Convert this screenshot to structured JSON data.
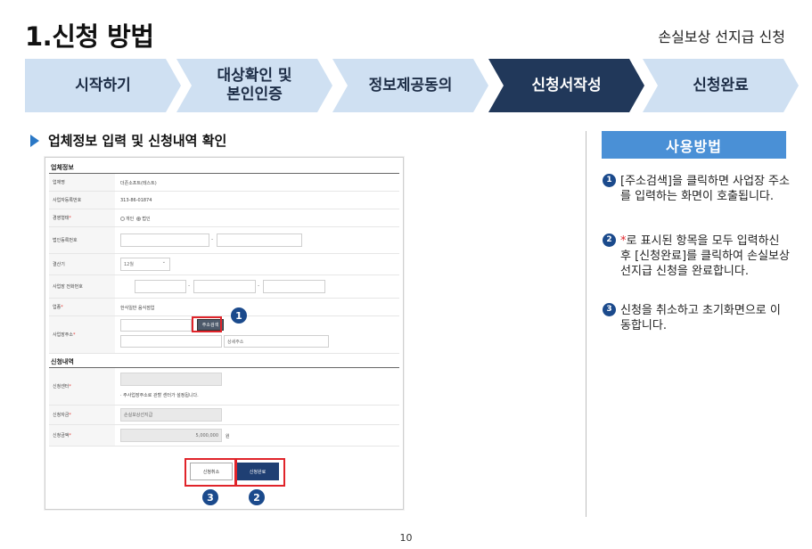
{
  "header": {
    "title": "1.신청 방법",
    "subtitle": "손실보상 선지급 신청"
  },
  "steps": [
    {
      "label": "시작하기",
      "active": false
    },
    {
      "label": "대상확인 및\n본인인증",
      "active": false
    },
    {
      "label": "정보제공동의",
      "active": false
    },
    {
      "label": "신청서작성",
      "active": true
    },
    {
      "label": "신청완료",
      "active": false
    }
  ],
  "colors": {
    "step_inactive": "#cfe0f2",
    "step_active": "#21385a",
    "accent": "#4a90d6",
    "highlight": "#e0242a",
    "badge": "#1b4a8c"
  },
  "section": {
    "heading": "업체정보 입력 및 신청내역 확인"
  },
  "form": {
    "company_title": "업체정보",
    "rows": {
      "company_name": {
        "label": "업체명",
        "value": "더존소프트(테스트)"
      },
      "biz_reg_no": {
        "label": "사업자등록번호",
        "value": "313-86-01874"
      },
      "biz_type": {
        "label": "경영형태",
        "opt1": "개인",
        "opt2": "법인"
      },
      "corp_reg_no": {
        "label": "법인등록번호"
      },
      "fiscal_month": {
        "label": "결산기",
        "value": "12월",
        "caret": "⌄"
      },
      "phone": {
        "label": "사업장 전화번호"
      },
      "industry": {
        "label": "업종",
        "value": "한식일반 음식점업"
      },
      "address": {
        "label": "사업장주소",
        "search_button": "주소검색",
        "detail_placeholder": "상세주소"
      }
    },
    "apply_title": "신청내역",
    "apply_rows": {
      "center": {
        "label": "신청센터",
        "note": "· 주사업장주소로 관할 센터가 설정됩니다."
      },
      "fund": {
        "label": "신청자금",
        "value": "손실보상선지급"
      },
      "amount": {
        "label": "신청금액",
        "value": "5,000,000",
        "unit": "원"
      }
    },
    "required_mark": "*",
    "cancel_button": "신청취소",
    "complete_button": "신청완료",
    "badges": [
      "1",
      "2",
      "3"
    ]
  },
  "usage": {
    "title": "사용방법",
    "items": [
      {
        "num": "1",
        "text": "[주소검색]을 클릭하면 사업장 주소를 입력하는 화면이 호출됩니다."
      },
      {
        "num": "2",
        "star": "*",
        "text": "로 표시된 항목을 모두 입력하신 후 [신청완료]를 클릭하여 손실보상 선지급 신청을 완료합니다."
      },
      {
        "num": "3",
        "text": "신청을 취소하고 초기화면으로 이동합니다."
      }
    ]
  },
  "footer": {
    "page_number": "10"
  }
}
